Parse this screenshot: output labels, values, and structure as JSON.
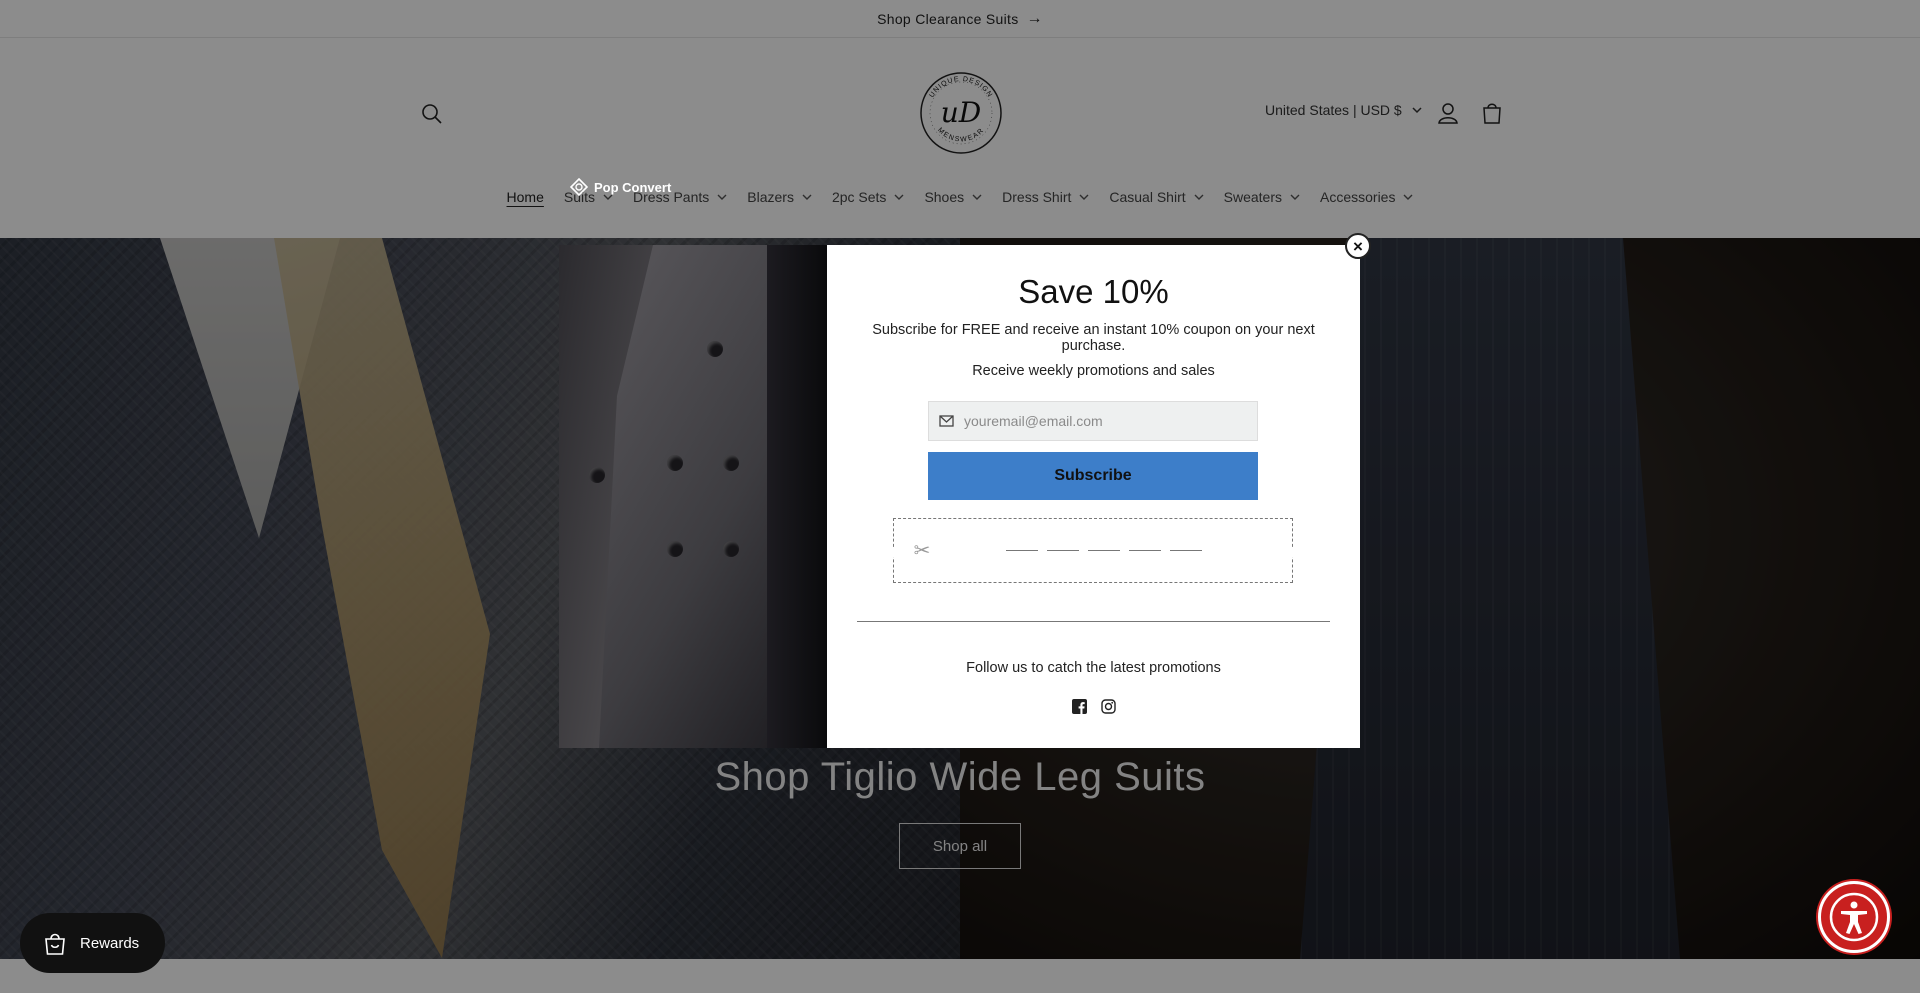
{
  "announcement": {
    "text": "Shop Clearance Suits",
    "arrow": "→"
  },
  "header": {
    "logo_alt": "UNIQUE DESIGN MENSWEAR",
    "locale": "United States | USD $"
  },
  "nav": {
    "items": [
      {
        "label": "Home",
        "has_dropdown": false,
        "active": true
      },
      {
        "label": "Suits",
        "has_dropdown": true
      },
      {
        "label": "Dress Pants",
        "has_dropdown": true
      },
      {
        "label": "Blazers",
        "has_dropdown": true
      },
      {
        "label": "2pc Sets",
        "has_dropdown": true
      },
      {
        "label": "Shoes",
        "has_dropdown": true
      },
      {
        "label": "Dress Shirt",
        "has_dropdown": true
      },
      {
        "label": "Casual Shirt",
        "has_dropdown": true
      },
      {
        "label": "Sweaters",
        "has_dropdown": true
      },
      {
        "label": "Accessories",
        "has_dropdown": true
      }
    ]
  },
  "popconvert": {
    "label": "Pop Convert"
  },
  "hero": {
    "title": "Shop Tiglio Wide Leg Suits",
    "button": "Shop all"
  },
  "modal": {
    "title": "Save 10%",
    "subtitle": "Subscribe for FREE and receive an instant 10% coupon on your next purchase.",
    "subtitle2": "Receive weekly promotions and sales",
    "email_placeholder": "youremail@email.com",
    "subscribe_label": "Subscribe",
    "follow_text": "Follow us to catch the latest promotions",
    "close_label": "×",
    "social_icons": [
      "facebook-icon",
      "instagram-icon"
    ]
  },
  "widgets": {
    "rewards_label": "Rewards"
  },
  "colors": {
    "subscribe_bg": "#3d7ec9",
    "accessibility_bg": "#c8201f",
    "rewards_bg": "#111111"
  }
}
